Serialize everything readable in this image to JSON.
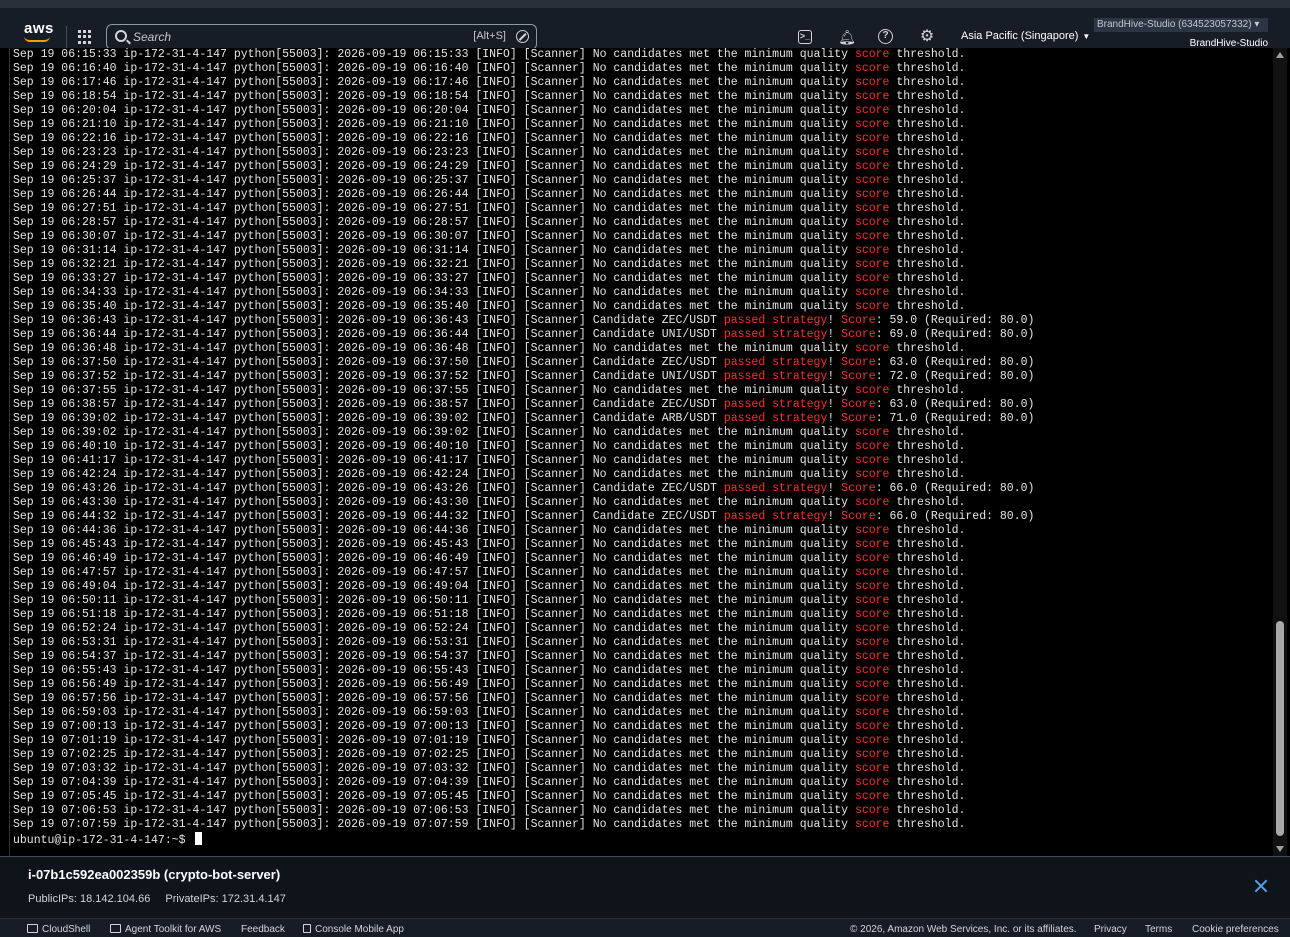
{
  "nav": {
    "logo": "aws",
    "search_placeholder": "Search",
    "search_shortcut": "[Alt+S]",
    "region": "Asia Pacific (Singapore)",
    "account_id_label": "BrandHive-Studio (634523057332) ▾",
    "account_name": "BrandHive-Studio",
    "icons": [
      "services-grid-icon",
      "search-icon",
      "cloudshell-icon",
      "bell-icon",
      "help-icon",
      "gear-icon"
    ]
  },
  "terminal": {
    "colors": {
      "text": "#e5e5e5",
      "highlight": "#ff2c2c",
      "background": "#000000"
    },
    "lines": [
      "Sep 19 06:15:33 ip-172-31-4-147 python[55003]: 2026-09-19 06:15:33 [INFO] [Scanner] No candidates met the minimum quality score threshold.",
      "Sep 19 06:16:40 ip-172-31-4-147 python[55003]: 2026-09-19 06:16:40 [INFO] [Scanner] No candidates met the minimum quality score threshold.",
      "Sep 19 06:17:46 ip-172-31-4-147 python[55003]: 2026-09-19 06:17:46 [INFO] [Scanner] No candidates met the minimum quality score threshold.",
      "Sep 19 06:18:54 ip-172-31-4-147 python[55003]: 2026-09-19 06:18:54 [INFO] [Scanner] No candidates met the minimum quality score threshold.",
      "Sep 19 06:20:04 ip-172-31-4-147 python[55003]: 2026-09-19 06:20:04 [INFO] [Scanner] No candidates met the minimum quality score threshold.",
      "Sep 19 06:21:10 ip-172-31-4-147 python[55003]: 2026-09-19 06:21:10 [INFO] [Scanner] No candidates met the minimum quality score threshold.",
      "Sep 19 06:22:16 ip-172-31-4-147 python[55003]: 2026-09-19 06:22:16 [INFO] [Scanner] No candidates met the minimum quality score threshold.",
      "Sep 19 06:23:23 ip-172-31-4-147 python[55003]: 2026-09-19 06:23:23 [INFO] [Scanner] No candidates met the minimum quality score threshold.",
      "Sep 19 06:24:29 ip-172-31-4-147 python[55003]: 2026-09-19 06:24:29 [INFO] [Scanner] No candidates met the minimum quality score threshold.",
      "Sep 19 06:25:37 ip-172-31-4-147 python[55003]: 2026-09-19 06:25:37 [INFO] [Scanner] No candidates met the minimum quality score threshold.",
      "Sep 19 06:26:44 ip-172-31-4-147 python[55003]: 2026-09-19 06:26:44 [INFO] [Scanner] No candidates met the minimum quality score threshold.",
      "Sep 19 06:27:51 ip-172-31-4-147 python[55003]: 2026-09-19 06:27:51 [INFO] [Scanner] No candidates met the minimum quality score threshold.",
      "Sep 19 06:28:57 ip-172-31-4-147 python[55003]: 2026-09-19 06:28:57 [INFO] [Scanner] No candidates met the minimum quality score threshold.",
      "Sep 19 06:30:07 ip-172-31-4-147 python[55003]: 2026-09-19 06:30:07 [INFO] [Scanner] No candidates met the minimum quality score threshold.",
      "Sep 19 06:31:14 ip-172-31-4-147 python[55003]: 2026-09-19 06:31:14 [INFO] [Scanner] No candidates met the minimum quality score threshold.",
      "Sep 19 06:32:21 ip-172-31-4-147 python[55003]: 2026-09-19 06:32:21 [INFO] [Scanner] No candidates met the minimum quality score threshold.",
      "Sep 19 06:33:27 ip-172-31-4-147 python[55003]: 2026-09-19 06:33:27 [INFO] [Scanner] No candidates met the minimum quality score threshold.",
      "Sep 19 06:34:33 ip-172-31-4-147 python[55003]: 2026-09-19 06:34:33 [INFO] [Scanner] No candidates met the minimum quality score threshold.",
      "Sep 19 06:35:40 ip-172-31-4-147 python[55003]: 2026-09-19 06:35:40 [INFO] [Scanner] No candidates met the minimum quality score threshold.",
      "Sep 19 06:36:43 ip-172-31-4-147 python[55003]: 2026-09-19 06:36:43 [INFO] [Scanner] Candidate ZEC/USDT passed strategy! Score: 59.0 (Required: 80.0)",
      "Sep 19 06:36:44 ip-172-31-4-147 python[55003]: 2026-09-19 06:36:44 [INFO] [Scanner] Candidate UNI/USDT passed strategy! Score: 69.0 (Required: 80.0)",
      "Sep 19 06:36:48 ip-172-31-4-147 python[55003]: 2026-09-19 06:36:48 [INFO] [Scanner] No candidates met the minimum quality score threshold.",
      "Sep 19 06:37:50 ip-172-31-4-147 python[55003]: 2026-09-19 06:37:50 [INFO] [Scanner] Candidate ZEC/USDT passed strategy! Score: 63.0 (Required: 80.0)",
      "Sep 19 06:37:52 ip-172-31-4-147 python[55003]: 2026-09-19 06:37:52 [INFO] [Scanner] Candidate UNI/USDT passed strategy! Score: 72.0 (Required: 80.0)",
      "Sep 19 06:37:55 ip-172-31-4-147 python[55003]: 2026-09-19 06:37:55 [INFO] [Scanner] No candidates met the minimum quality score threshold.",
      "Sep 19 06:38:57 ip-172-31-4-147 python[55003]: 2026-09-19 06:38:57 [INFO] [Scanner] Candidate ZEC/USDT passed strategy! Score: 63.0 (Required: 80.0)",
      "Sep 19 06:39:02 ip-172-31-4-147 python[55003]: 2026-09-19 06:39:02 [INFO] [Scanner] Candidate ARB/USDT passed strategy! Score: 71.0 (Required: 80.0)",
      "Sep 19 06:39:02 ip-172-31-4-147 python[55003]: 2026-09-19 06:39:02 [INFO] [Scanner] No candidates met the minimum quality score threshold.",
      "Sep 19 06:40:10 ip-172-31-4-147 python[55003]: 2026-09-19 06:40:10 [INFO] [Scanner] No candidates met the minimum quality score threshold.",
      "Sep 19 06:41:17 ip-172-31-4-147 python[55003]: 2026-09-19 06:41:17 [INFO] [Scanner] No candidates met the minimum quality score threshold.",
      "Sep 19 06:42:24 ip-172-31-4-147 python[55003]: 2026-09-19 06:42:24 [INFO] [Scanner] No candidates met the minimum quality score threshold.",
      "Sep 19 06:43:26 ip-172-31-4-147 python[55003]: 2026-09-19 06:43:26 [INFO] [Scanner] Candidate ZEC/USDT passed strategy! Score: 66.0 (Required: 80.0)",
      "Sep 19 06:43:30 ip-172-31-4-147 python[55003]: 2026-09-19 06:43:30 [INFO] [Scanner] No candidates met the minimum quality score threshold.",
      "Sep 19 06:44:32 ip-172-31-4-147 python[55003]: 2026-09-19 06:44:32 [INFO] [Scanner] Candidate ZEC/USDT passed strategy! Score: 66.0 (Required: 80.0)",
      "Sep 19 06:44:36 ip-172-31-4-147 python[55003]: 2026-09-19 06:44:36 [INFO] [Scanner] No candidates met the minimum quality score threshold.",
      "Sep 19 06:45:43 ip-172-31-4-147 python[55003]: 2026-09-19 06:45:43 [INFO] [Scanner] No candidates met the minimum quality score threshold.",
      "Sep 19 06:46:49 ip-172-31-4-147 python[55003]: 2026-09-19 06:46:49 [INFO] [Scanner] No candidates met the minimum quality score threshold.",
      "Sep 19 06:47:57 ip-172-31-4-147 python[55003]: 2026-09-19 06:47:57 [INFO] [Scanner] No candidates met the minimum quality score threshold.",
      "Sep 19 06:49:04 ip-172-31-4-147 python[55003]: 2026-09-19 06:49:04 [INFO] [Scanner] No candidates met the minimum quality score threshold.",
      "Sep 19 06:50:11 ip-172-31-4-147 python[55003]: 2026-09-19 06:50:11 [INFO] [Scanner] No candidates met the minimum quality score threshold.",
      "Sep 19 06:51:18 ip-172-31-4-147 python[55003]: 2026-09-19 06:51:18 [INFO] [Scanner] No candidates met the minimum quality score threshold.",
      "Sep 19 06:52:24 ip-172-31-4-147 python[55003]: 2026-09-19 06:52:24 [INFO] [Scanner] No candidates met the minimum quality score threshold.",
      "Sep 19 06:53:31 ip-172-31-4-147 python[55003]: 2026-09-19 06:53:31 [INFO] [Scanner] No candidates met the minimum quality score threshold.",
      "Sep 19 06:54:37 ip-172-31-4-147 python[55003]: 2026-09-19 06:54:37 [INFO] [Scanner] No candidates met the minimum quality score threshold.",
      "Sep 19 06:55:43 ip-172-31-4-147 python[55003]: 2026-09-19 06:55:43 [INFO] [Scanner] No candidates met the minimum quality score threshold.",
      "Sep 19 06:56:49 ip-172-31-4-147 python[55003]: 2026-09-19 06:56:49 [INFO] [Scanner] No candidates met the minimum quality score threshold.",
      "Sep 19 06:57:56 ip-172-31-4-147 python[55003]: 2026-09-19 06:57:56 [INFO] [Scanner] No candidates met the minimum quality score threshold.",
      "Sep 19 06:59:03 ip-172-31-4-147 python[55003]: 2026-09-19 06:59:03 [INFO] [Scanner] No candidates met the minimum quality score threshold.",
      "Sep 19 07:00:13 ip-172-31-4-147 python[55003]: 2026-09-19 07:00:13 [INFO] [Scanner] No candidates met the minimum quality score threshold.",
      "Sep 19 07:01:19 ip-172-31-4-147 python[55003]: 2026-09-19 07:01:19 [INFO] [Scanner] No candidates met the minimum quality score threshold.",
      "Sep 19 07:02:25 ip-172-31-4-147 python[55003]: 2026-09-19 07:02:25 [INFO] [Scanner] No candidates met the minimum quality score threshold.",
      "Sep 19 07:03:32 ip-172-31-4-147 python[55003]: 2026-09-19 07:03:32 [INFO] [Scanner] No candidates met the minimum quality score threshold.",
      "Sep 19 07:04:39 ip-172-31-4-147 python[55003]: 2026-09-19 07:04:39 [INFO] [Scanner] No candidates met the minimum quality score threshold.",
      "Sep 19 07:05:45 ip-172-31-4-147 python[55003]: 2026-09-19 07:05:45 [INFO] [Scanner] No candidates met the minimum quality score threshold.",
      "Sep 19 07:06:53 ip-172-31-4-147 python[55003]: 2026-09-19 07:06:53 [INFO] [Scanner] No candidates met the minimum quality score threshold.",
      "Sep 19 07:07:59 ip-172-31-4-147 python[55003]: 2026-09-19 07:07:59 [INFO] [Scanner] No candidates met the minimum quality score threshold."
    ],
    "prompt": "ubuntu@ip-172-31-4-147:~$ "
  },
  "instance": {
    "title": "i-07b1c592ea002359b (crypto-bot-server)",
    "public_ips": "PublicIPs: 18.142.104.66",
    "private_ips": "PrivateIPs: 172.31.4.147"
  },
  "footer": {
    "cloudshell": "CloudShell",
    "agent_toolkit": "Agent Toolkit for AWS",
    "feedback": "Feedback",
    "mobile_app": "Console Mobile App",
    "copyright": "© 2026, Amazon Web Services, Inc. or its affiliates.",
    "privacy": "Privacy",
    "terms": "Terms",
    "cookies": "Cookie preferences"
  }
}
